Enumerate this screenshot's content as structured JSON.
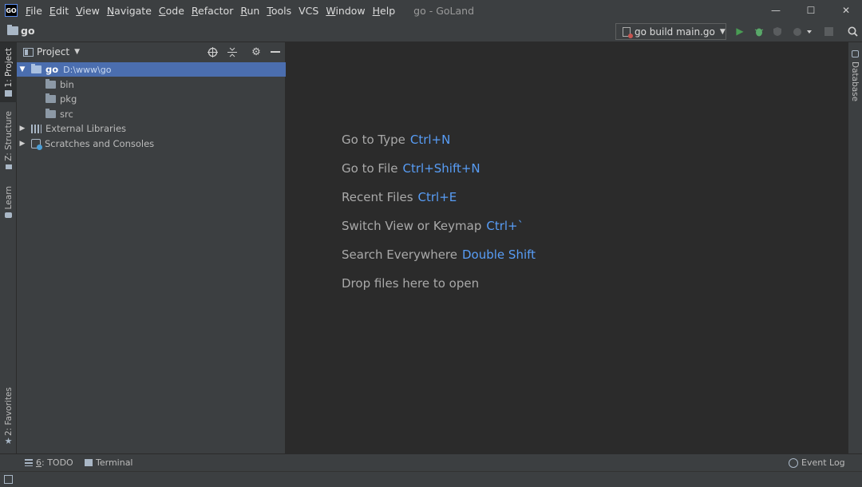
{
  "app": {
    "logo_text": "GO",
    "window_title": "go - GoLand"
  },
  "menu": [
    {
      "mn": "F",
      "rest": "ile"
    },
    {
      "mn": "E",
      "rest": "dit"
    },
    {
      "mn": "V",
      "rest": "iew"
    },
    {
      "mn": "N",
      "rest": "avigate"
    },
    {
      "mn": "C",
      "rest": "ode"
    },
    {
      "mn": "R",
      "rest": "efactor"
    },
    {
      "mn": "R",
      "rest": "un"
    },
    {
      "mn": "T",
      "rest": "ools"
    },
    {
      "mn": "",
      "rest": "VCS"
    },
    {
      "mn": "W",
      "rest": "indow"
    },
    {
      "mn": "H",
      "rest": "elp"
    }
  ],
  "window_controls": {
    "minimize": "—",
    "maximize": "☐",
    "close": "✕"
  },
  "navbar": {
    "root": "go",
    "run_config": "go build main.go"
  },
  "left_tabs": {
    "project": "1: Project",
    "structure": "Z: Structure",
    "learn": "Learn",
    "favorites": "2: Favorites"
  },
  "right_tabs": {
    "database": "Database"
  },
  "project_panel": {
    "title": "Project",
    "tree": {
      "root_name": "go",
      "root_path": "D:\\www\\go",
      "children": [
        "bin",
        "pkg",
        "src"
      ],
      "external_libraries": "External Libraries",
      "scratches": "Scratches and Consoles"
    }
  },
  "editor_hints": [
    {
      "label": "Go to Type",
      "key": "Ctrl+N"
    },
    {
      "label": "Go to File",
      "key": "Ctrl+Shift+N"
    },
    {
      "label": "Recent Files",
      "key": "Ctrl+E"
    },
    {
      "label": "Switch View or Keymap",
      "key": "Ctrl+`"
    },
    {
      "label": "Search Everywhere",
      "key": "Double Shift"
    },
    {
      "label": "Drop files here to open",
      "key": ""
    }
  ],
  "bottom_bar": {
    "todo_mn": "6",
    "todo_rest": ": TODO",
    "terminal": "Terminal",
    "event_log": "Event Log"
  },
  "colors": {
    "accent_blue": "#589df6",
    "selection": "#4b6eaf",
    "run_green": "#499c54",
    "debug_green": "#59a869"
  }
}
